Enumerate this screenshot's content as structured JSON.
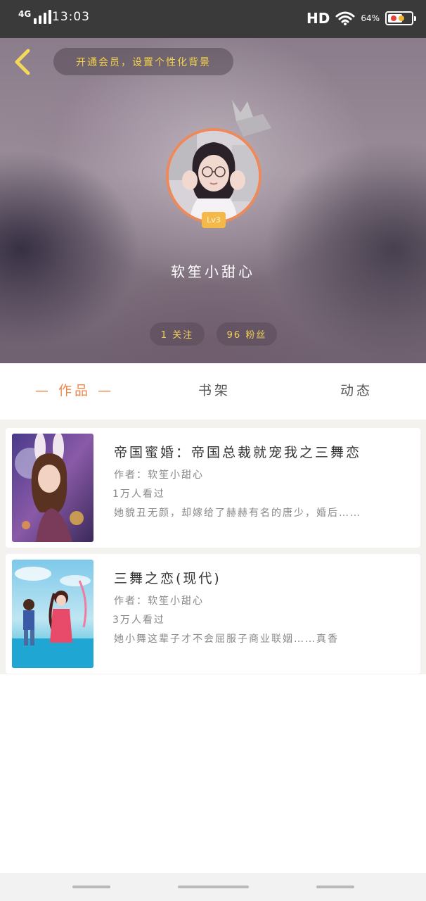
{
  "status_bar": {
    "network": "4G",
    "time": "13:03",
    "hd": "HD",
    "battery_text": "64%",
    "battery_level": 0.64,
    "icons": [
      "signal-icon",
      "wifi-icon",
      "battery-icon"
    ]
  },
  "header": {
    "back_icon": "chevron-left-icon",
    "vip_prompt": "开通会员，设置个性化背景",
    "level": "Lv3",
    "nickname": "软笙小甜心",
    "follow_stat": "1 关注",
    "fans_stat": "96 粉丝"
  },
  "tabs": [
    {
      "label": "— 作品 —",
      "active": true
    },
    {
      "label": "书架",
      "active": false
    },
    {
      "label": "动态",
      "active": false
    }
  ],
  "books": [
    {
      "title": "帝国蜜婚：帝国总裁就宠我之三舞恋",
      "author": "作者：软笙小甜心",
      "views": "1万人看过",
      "description": "她貌丑无颜，却嫁给了赫赫有名的唐少，婚后……"
    },
    {
      "title": "三舞之恋(现代)",
      "author": "作者：软笙小甜心",
      "views": "3万人看过",
      "description": "她小舞这辈子才不会屈服子商业联姻……真香"
    }
  ],
  "colors": {
    "accent": "#e8884f",
    "gold": "#f3cf5a",
    "avatar_ring": "#ee8a5a",
    "badge": "#f5b94a",
    "list_bg": "#f4f2ee"
  }
}
